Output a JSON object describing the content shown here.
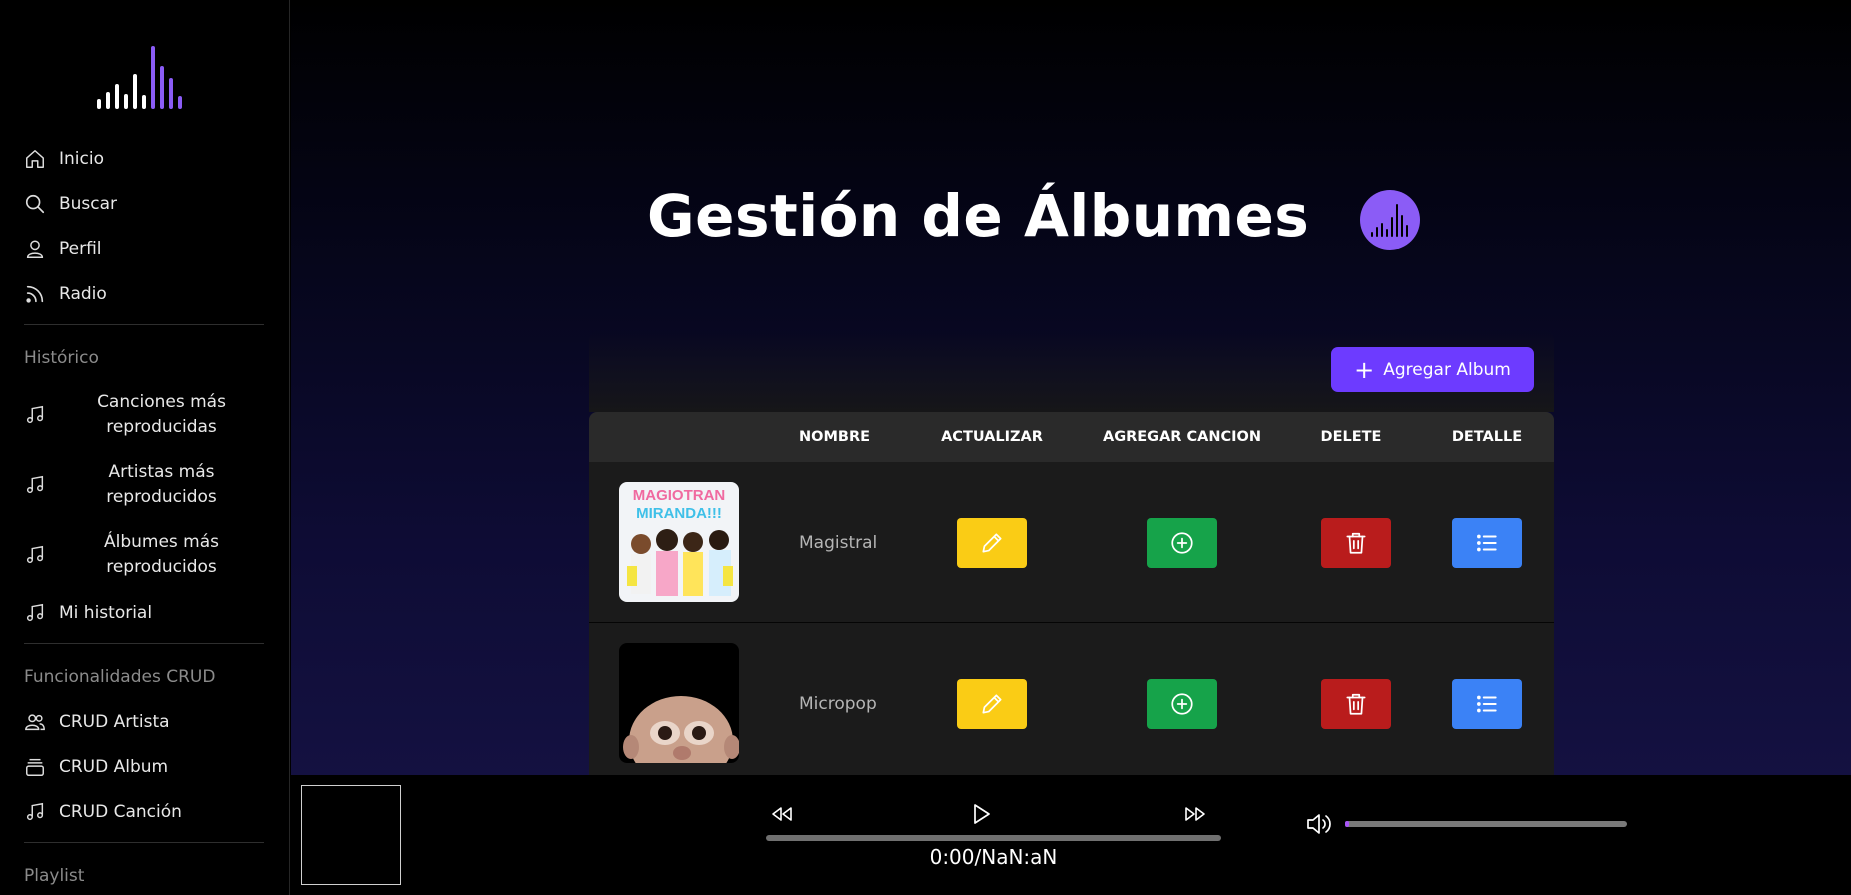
{
  "sidebar": {
    "nav": [
      {
        "label": "Inicio",
        "icon": "home-icon"
      },
      {
        "label": "Buscar",
        "icon": "search-icon"
      },
      {
        "label": "Perfil",
        "icon": "user-icon"
      },
      {
        "label": "Radio",
        "icon": "rss-icon"
      }
    ],
    "historico_label": "Histórico",
    "historico": [
      {
        "label": "Canciones más reproducidas",
        "icon": "music-note-icon"
      },
      {
        "label": "Artistas más reproducidos",
        "icon": "music-note-icon"
      },
      {
        "label": "Álbumes más reproducidos",
        "icon": "music-note-icon"
      },
      {
        "label": "Mi historial",
        "icon": "music-note-icon"
      }
    ],
    "crud_label": "Funcionalidades CRUD",
    "crud": [
      {
        "label": "CRUD Artista",
        "icon": "users-icon"
      },
      {
        "label": "CRUD Album",
        "icon": "album-stack-icon"
      },
      {
        "label": "CRUD Canción",
        "icon": "music-note-icon"
      }
    ],
    "playlist_label": "Playlist"
  },
  "main": {
    "title": "Gestión de Álbumes",
    "add_button_label": "Agregar Album",
    "table": {
      "headers": [
        "NOMBRE",
        "ACTUALIZAR",
        "AGREGAR CANCION",
        "DELETE",
        "DETALLE"
      ],
      "rows": [
        {
          "name": "Magistral",
          "cover_text": [
            "MAGIOTRAN",
            "MIRANDA!!!"
          ]
        },
        {
          "name": "Micropop"
        }
      ]
    }
  },
  "player": {
    "time": "0:00/NaN:aN",
    "progress": 0,
    "volume": 0.01
  },
  "colors": {
    "accent": "#6d3bff",
    "update": "#facc15",
    "add_song": "#16a34a",
    "delete": "#b91c1c",
    "detail": "#3b82f6"
  }
}
